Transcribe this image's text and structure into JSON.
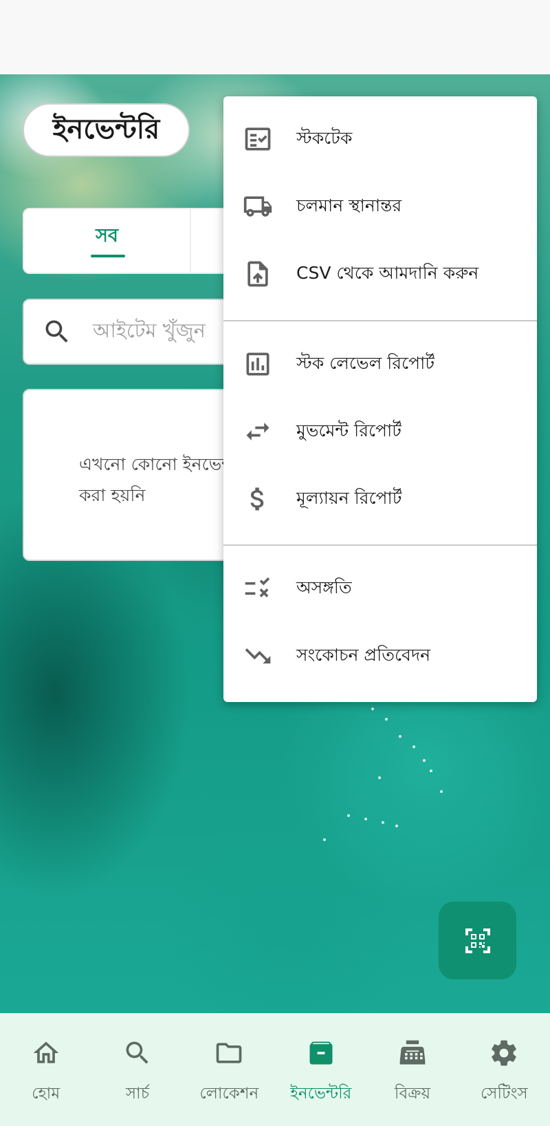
{
  "page": {
    "title": "ইনভেন্টরি"
  },
  "tabs": [
    {
      "label": "সব",
      "selected": true
    }
  ],
  "search": {
    "placeholder": "আইটেম খুঁজুন"
  },
  "empty_state": {
    "message": "এখনো কোনো ইনভেন্টরি আইটেম যোগ করা হয়নি"
  },
  "menu": {
    "groups": [
      [
        {
          "label": "স্টকটেক",
          "icon": "checklist-icon"
        },
        {
          "label": "চলমান স্থানান্তর",
          "icon": "truck-icon"
        },
        {
          "label": "CSV থেকে আমদানি করুন",
          "icon": "file-upload-icon"
        }
      ],
      [
        {
          "label": "স্টক লেভেল রিপোর্ট",
          "icon": "bar-chart-icon"
        },
        {
          "label": "মুভমেন্ট রিপোর্ট",
          "icon": "swap-arrows-icon"
        },
        {
          "label": "মূল্যায়ন রিপোর্ট",
          "icon": "dollar-icon"
        }
      ],
      [
        {
          "label": "অসঙ্গতি",
          "icon": "rule-mismatch-icon"
        },
        {
          "label": "সংকোচন প্রতিবেদন",
          "icon": "trending-down-icon"
        }
      ]
    ]
  },
  "fab": {
    "icon": "qr-scan-icon"
  },
  "bottom_nav": {
    "items": [
      {
        "label": "হোম",
        "icon": "home-icon",
        "active": false
      },
      {
        "label": "সার্চ",
        "icon": "search-icon",
        "active": false
      },
      {
        "label": "লোকেশন",
        "icon": "folder-icon",
        "active": false
      },
      {
        "label": "ইনভেন্টরি",
        "icon": "inventory-box-icon",
        "active": true
      },
      {
        "label": "বিক্রয়",
        "icon": "cash-register-icon",
        "active": false
      },
      {
        "label": "সেটিংস",
        "icon": "gear-icon",
        "active": false
      }
    ]
  },
  "colors": {
    "accent": "#0f8f6a",
    "nav_background": "#e6f8ee",
    "fab": "#0f9070"
  }
}
